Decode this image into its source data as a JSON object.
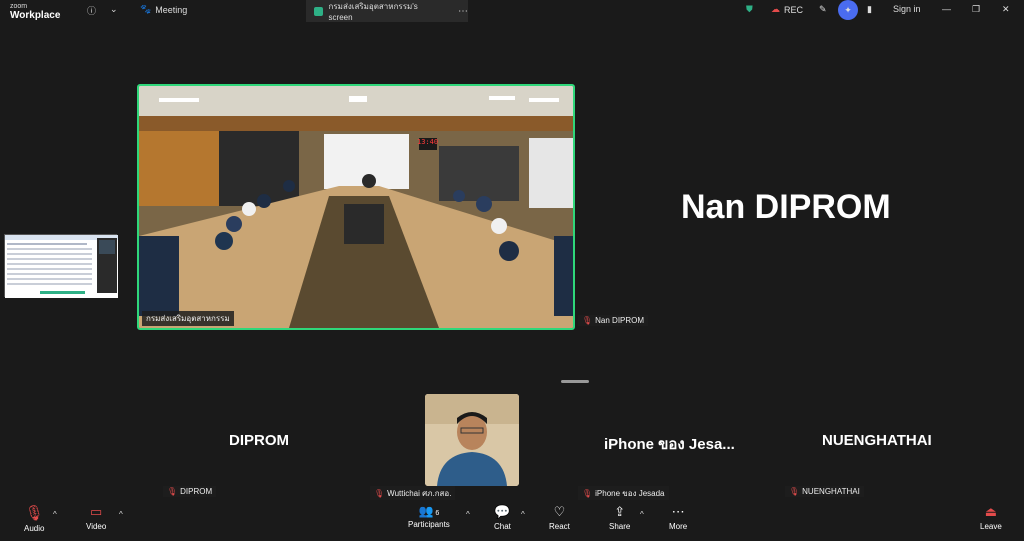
{
  "app": {
    "logo_top": "zoom",
    "logo_bottom": "Workplace"
  },
  "topbar": {
    "meeting_label": "Meeting",
    "screen_tab": "กรมส่งเสริมอุตสาหกรรม's screen",
    "rec_label": "REC",
    "signin_label": "Sign in"
  },
  "stage": {
    "main_video_name": "กรมส่งเสริมอุตสาหกรรม",
    "speaker_big_name": "Nan DIPROM",
    "speaker_tag": "Nan DIPROM",
    "tiles": [
      {
        "display": "DIPROM",
        "tag": "DIPROM"
      },
      {
        "display": "",
        "tag": "Wuttichai ศภ.กสอ."
      },
      {
        "display": "iPhone ของ Jesa...",
        "tag": "iPhone ของ Jesada"
      },
      {
        "display": "NUENGHATHAI",
        "tag": "NUENGHATHAI"
      }
    ],
    "clock": "13:40"
  },
  "toolbar": {
    "audio": "Audio",
    "video": "Video",
    "participants": "Participants",
    "participants_count": "6",
    "chat": "Chat",
    "react": "React",
    "share": "Share",
    "more": "More",
    "leave": "Leave"
  },
  "colors": {
    "active_border": "#2fd77a",
    "leave": "#e34b4b"
  }
}
